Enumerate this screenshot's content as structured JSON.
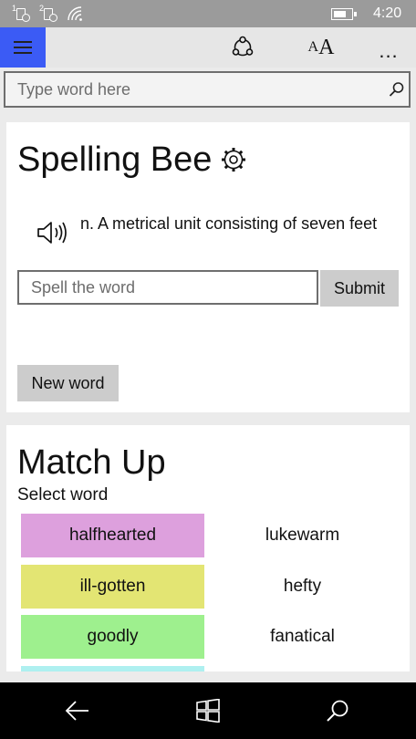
{
  "status_bar": {
    "sim1": "1",
    "sim2": "2",
    "time": "4:20"
  },
  "app_bar": {
    "icons": [
      "hamburger-menu-icon",
      "share-icon",
      "font-size-icon",
      "more-options-icon"
    ],
    "font_small": "A",
    "font_large": "A",
    "more": "..."
  },
  "search": {
    "placeholder": "Type word here"
  },
  "spelling_bee": {
    "title": "Spelling Bee",
    "definition": "n. A metrical unit consisting of seven feet",
    "input_placeholder": "Spell the word",
    "submit_label": "Submit",
    "new_word_label": "New word"
  },
  "match_up": {
    "title": "Match Up",
    "subtitle": "Select word",
    "rows": [
      {
        "left": "halfhearted",
        "right": "lukewarm",
        "color": "#dda0dd"
      },
      {
        "left": "ill-gotten",
        "right": "hefty",
        "color": "#e3e573"
      },
      {
        "left": "goodly",
        "right": "fanatical",
        "color": "#9ef08e"
      },
      {
        "left": "",
        "right": "",
        "color": "#aef0f0"
      }
    ]
  },
  "colors": {
    "accent": "#3b5bf5",
    "status_bar": "#9b9b9b",
    "nav_bar": "#000000",
    "button": "#cccccc"
  }
}
